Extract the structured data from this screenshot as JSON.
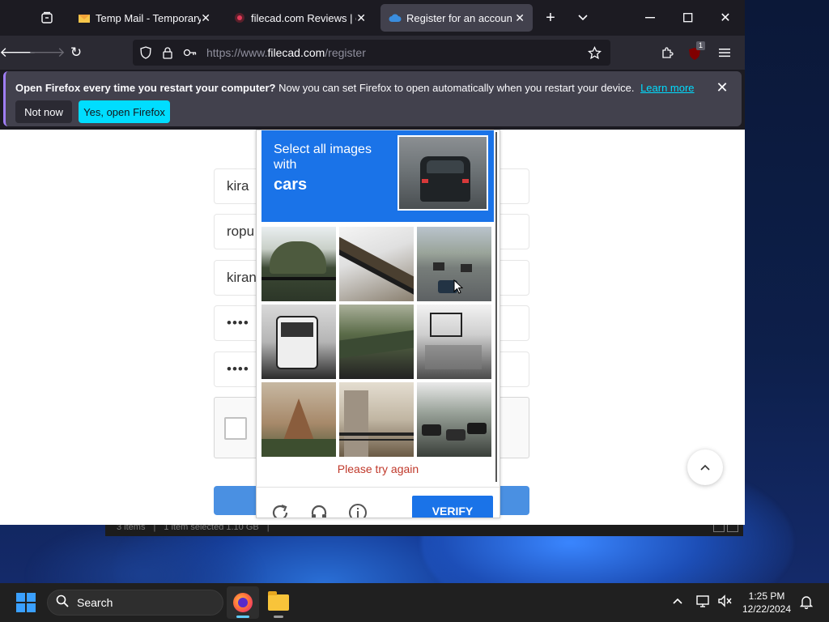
{
  "browser": {
    "tabs": [
      {
        "label": "Temp Mail - Temporary Disposable Email",
        "favicon": "envelope-icon",
        "active": false
      },
      {
        "label": "filecad.com Reviews | check if site is scam",
        "favicon": "scam-site-icon",
        "active": false
      },
      {
        "label": "Register for an account - filecad",
        "favicon": "cloud-icon",
        "active": true
      }
    ],
    "url": {
      "domain_prefix": "https://www.",
      "domain": "filecad.com",
      "path": "/register"
    },
    "extension_badge": "1"
  },
  "notification": {
    "title": "Open Firefox every time you restart your computer?",
    "message": "Now you can set Firefox to open automatically when you restart your device.",
    "learn_more": "Learn more",
    "not_now": "Not now",
    "yes": "Yes, open Firefox"
  },
  "form": {
    "first_name": "kira",
    "last_name": "ropu",
    "username": "kiran",
    "password": "••••",
    "confirm_password": "••••"
  },
  "captcha": {
    "instruction": "Select all images with",
    "target": "cars",
    "error": "Please try again",
    "verify": "VERIFY"
  },
  "explorer": {
    "items": "3 items",
    "selected": "1 item selected  1.10 GB"
  },
  "taskbar": {
    "search_placeholder": "Search",
    "time": "1:25 PM",
    "date": "12/22/2024"
  },
  "colors": {
    "captcha_blue": "#1a73e8",
    "firefox_accent": "#00ddff",
    "error_red": "#c0392b"
  }
}
